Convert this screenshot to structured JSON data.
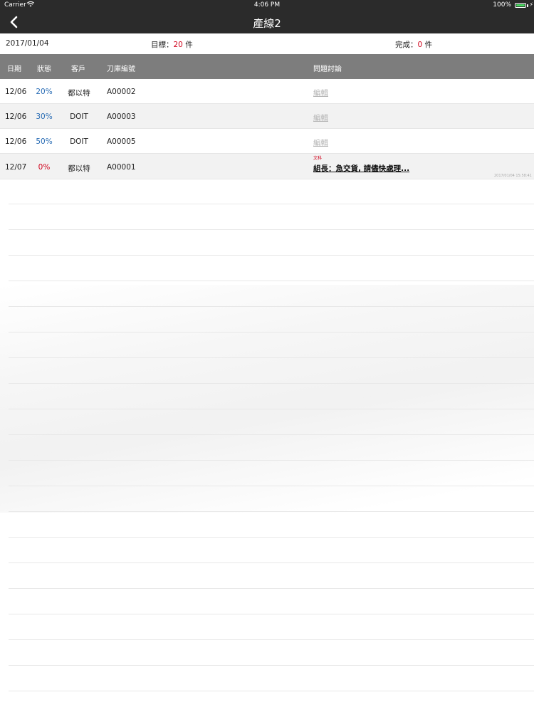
{
  "status_bar": {
    "carrier": "Carrier",
    "time": "4:06 PM",
    "battery": "100%",
    "battery_level": 1.0,
    "wifi_icon": "wifi-icon",
    "battery_icon": "battery-icon"
  },
  "nav": {
    "title": "產線2",
    "back_icon": "chevron-left-icon"
  },
  "summary": {
    "date": "2017/01/04",
    "target_label": "目標：",
    "target_value": "20",
    "target_unit": " 件",
    "done_label": "完成：",
    "done_value": "0",
    "done_unit": " 件"
  },
  "table": {
    "headers": [
      "日期",
      "狀態",
      "客戶",
      "刀庫編號",
      "問題討論"
    ],
    "rows": [
      {
        "date": "12/06",
        "status": "20%",
        "customer": "都以特",
        "knife_no": "A00002",
        "issue": "編輯"
      },
      {
        "date": "12/06",
        "status": "30%",
        "customer": "DOIT",
        "knife_no": "A00003",
        "issue": "編輯"
      },
      {
        "date": "12/06",
        "status": "50%",
        "customer": "DOIT",
        "knife_no": "A00005",
        "issue": "編輯"
      },
      {
        "date": "12/07",
        "status": "0%",
        "customer": "都以特",
        "knife_no": "A00001",
        "issue": "組長：急交貨, 請儘快處理...",
        "issue_author": "文科",
        "issue_time": "2017/01/04 15:58:41"
      }
    ]
  },
  "colors": {
    "bar_background": "#2b2b2b",
    "header_background": "#7d7d7d",
    "status_blue": "#2a6db5",
    "status_red": "#d0021b",
    "row_alt": "#f2f2f2"
  }
}
